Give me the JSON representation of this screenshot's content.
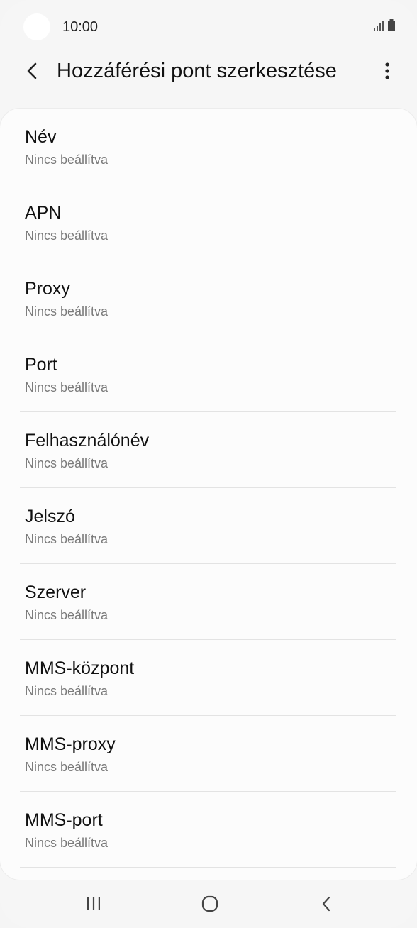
{
  "status_bar": {
    "time": "10:00",
    "icons": [
      "signal-icon",
      "battery-icon"
    ]
  },
  "header": {
    "back_icon": "chevron-left-icon",
    "title": "Hozzáférési pont szerkesztése",
    "more_icon": "more-vert-icon"
  },
  "fields": [
    {
      "label": "Név",
      "value": "Nincs beállítva"
    },
    {
      "label": "APN",
      "value": "Nincs beállítva"
    },
    {
      "label": "Proxy",
      "value": "Nincs beállítva"
    },
    {
      "label": "Port",
      "value": "Nincs beállítva"
    },
    {
      "label": "Felhasználónév",
      "value": "Nincs beállítva"
    },
    {
      "label": "Jelszó",
      "value": "Nincs beállítva"
    },
    {
      "label": "Szerver",
      "value": "Nincs beállítva"
    },
    {
      "label": "MMS-központ",
      "value": "Nincs beállítva"
    },
    {
      "label": "MMS-proxy",
      "value": "Nincs beállítva"
    },
    {
      "label": "MMS-port",
      "value": "Nincs beállítva"
    }
  ],
  "nav_bar": {
    "recent_icon": "recent-apps-icon",
    "home_icon": "home-icon",
    "back_icon": "back-icon"
  },
  "colors": {
    "background": "#f6f6f6",
    "card": "#fcfcfc",
    "title_text": "#111111",
    "subtitle_text": "#7a7a7a",
    "divider": "#e3e3e3"
  }
}
